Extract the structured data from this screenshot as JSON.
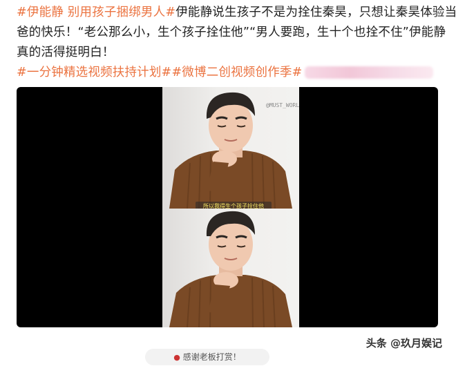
{
  "post": {
    "hashtag_1": "#伊能静 别用孩子捆绑男人#",
    "line1_text": "伊能静说生孩子不是为拴住秦昊，只想让秦昊体验当",
    "line2_text": "爸的快乐！“老公那么小，生个孩子拴住他”“男人要跑，生十个也拴不住”伊能静",
    "line3_text": "真的活得挺明白！",
    "hashtag_2": "#一分钟精选视频扶持计划#",
    "hashtag_3": "#微博二创视频创作季#"
  },
  "video": {
    "watermark": "@MUST_WORLD",
    "subtitle": "所以我得生个孩子拴住他"
  },
  "footer": {
    "reward_label": "感谢老板打赏！"
  },
  "author": {
    "watermark": "头条 @玖月娱记"
  },
  "colors": {
    "hashtag": "#eb7340",
    "video_bg": "#000000",
    "sweater": "#7a4a26"
  }
}
